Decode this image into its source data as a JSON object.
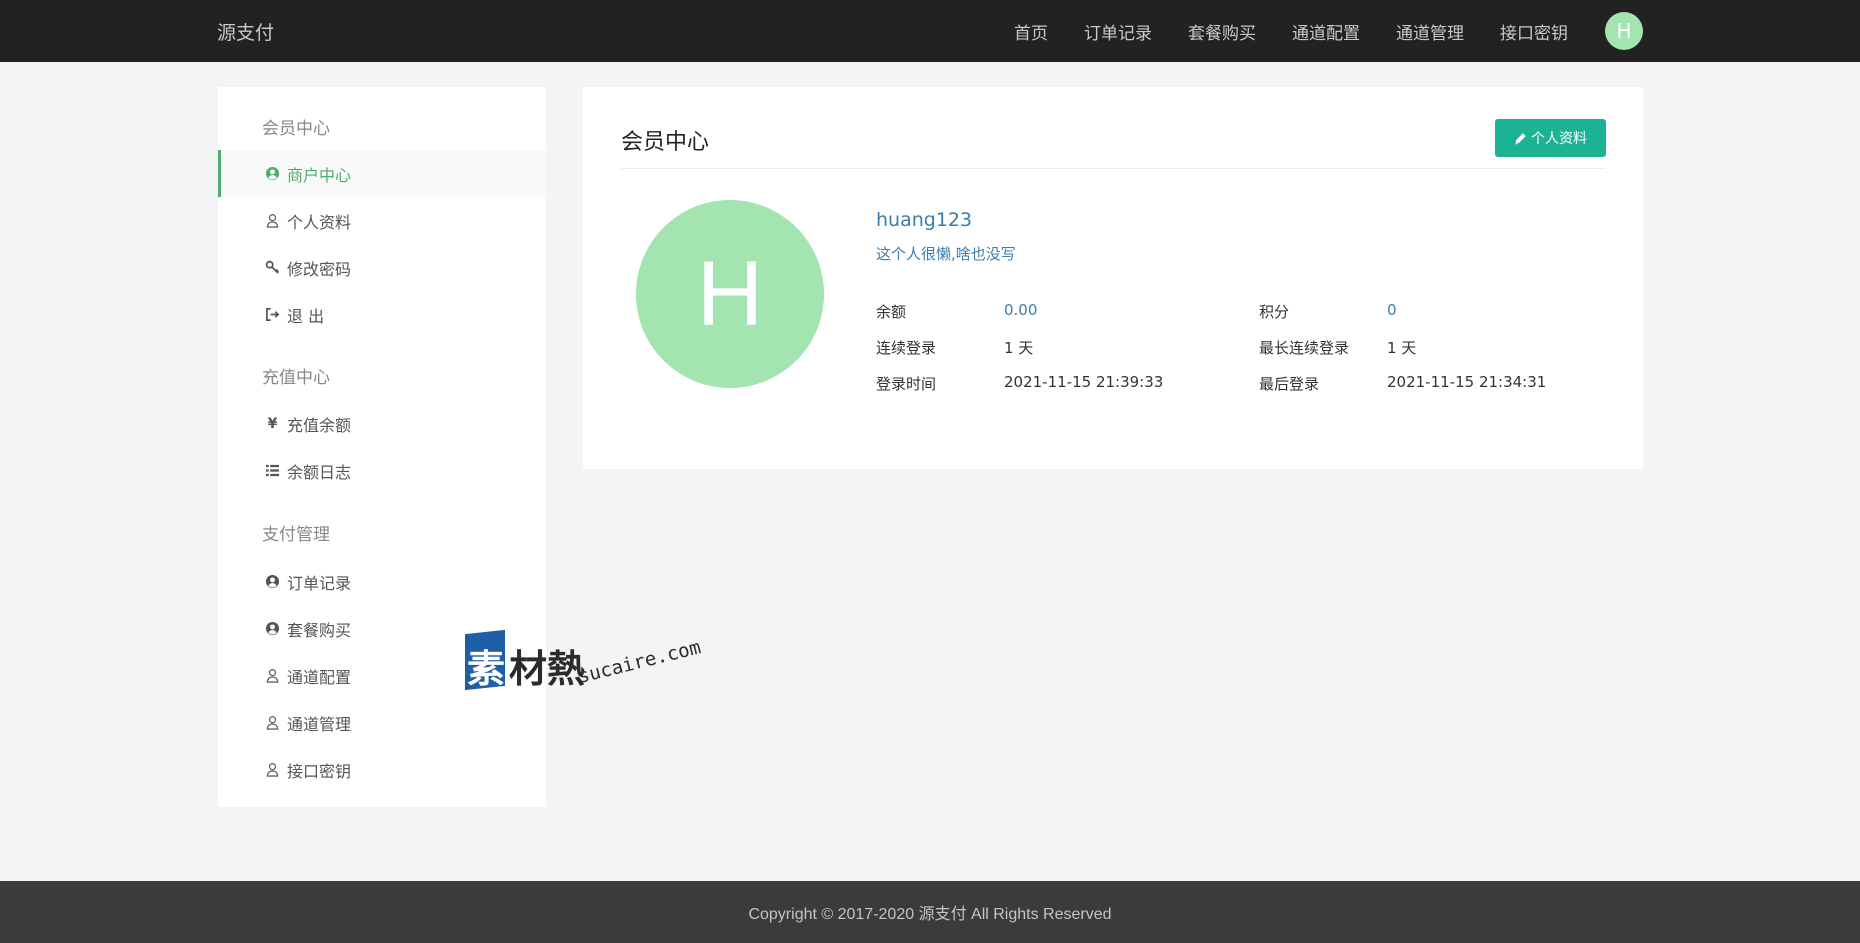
{
  "navbar": {
    "brand": "源支付",
    "items": [
      "首页",
      "订单记录",
      "套餐购买",
      "通道配置",
      "通道管理",
      "接口密钥"
    ],
    "avatar_letter": "H"
  },
  "sidebar": {
    "groups": [
      {
        "title": "会员中心",
        "items": [
          {
            "label": "商户中心",
            "icon": "user-circle-icon",
            "active": true
          },
          {
            "label": "个人资料",
            "icon": "user-icon"
          },
          {
            "label": "修改密码",
            "icon": "key-icon"
          },
          {
            "label": "退 出",
            "icon": "sign-out-icon"
          }
        ]
      },
      {
        "title": "充值中心",
        "items": [
          {
            "label": "充值余额",
            "icon": "yen-icon"
          },
          {
            "label": "余额日志",
            "icon": "list-icon"
          }
        ]
      },
      {
        "title": "支付管理",
        "items": [
          {
            "label": "订单记录",
            "icon": "user-circle-icon"
          },
          {
            "label": "套餐购买",
            "icon": "user-circle-icon"
          },
          {
            "label": "通道配置",
            "icon": "user-icon"
          },
          {
            "label": "通道管理",
            "icon": "user-icon"
          },
          {
            "label": "接口密钥",
            "icon": "user-icon"
          }
        ]
      }
    ]
  },
  "panel": {
    "title": "会员中心",
    "profile_button": "个人资料",
    "avatar_letter": "H",
    "username": "huang123",
    "bio": "这个人很懒,啥也没写",
    "stats": {
      "balance_label": "余额",
      "balance_value": "0.00",
      "points_label": "积分",
      "points_value": "0",
      "streak_label": "连续登录",
      "streak_value": "1 天",
      "max_streak_label": "最长连续登录",
      "max_streak_value": "1 天",
      "login_time_label": "登录时间",
      "login_time_value": "2021-11-15 21:39:33",
      "last_login_label": "最后登录",
      "last_login_value": "2021-11-15 21:34:31"
    }
  },
  "watermark": {
    "char1": "素",
    "chars": "材熱",
    "url": "sucaire.com"
  },
  "footer": {
    "copyright": "Copyright © 2017-2020 源支付 All Rights Reserved"
  },
  "colors": {
    "navbar": "#222222",
    "accent_green": "#4cae70",
    "button_teal": "#1bb394",
    "avatar": "#a3e4b1",
    "link_blue": "#3c7dab"
  }
}
